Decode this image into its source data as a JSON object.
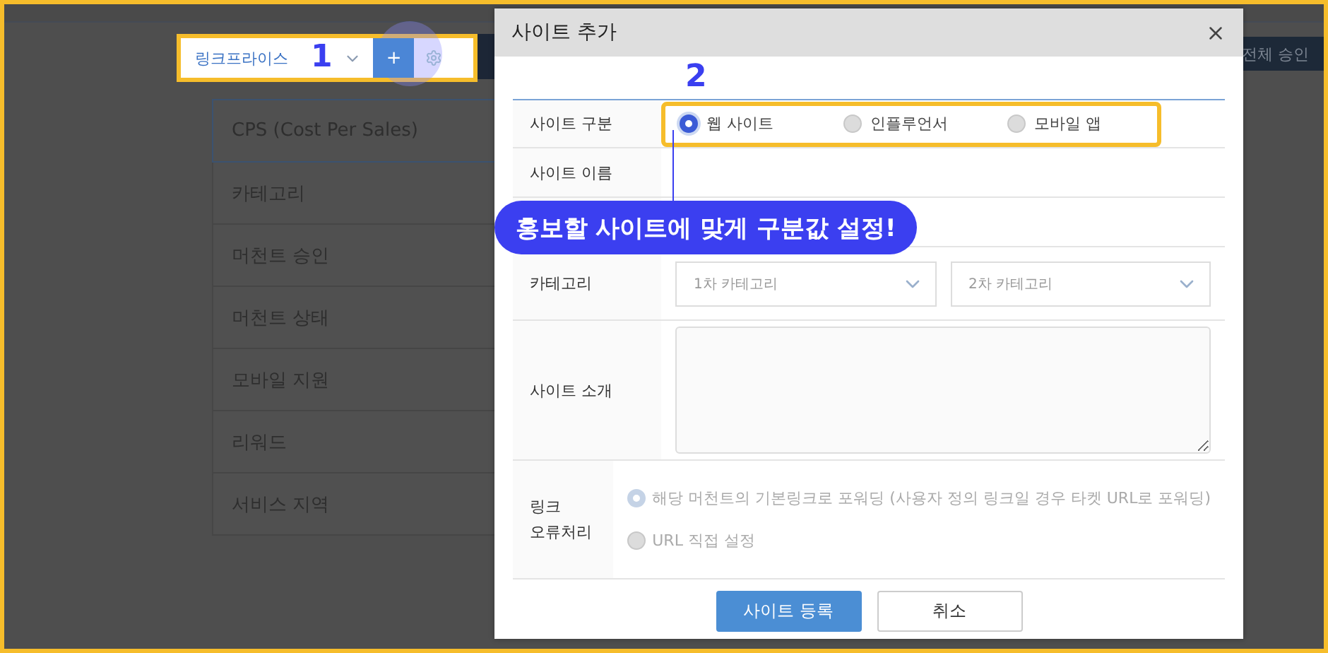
{
  "toolbar": {
    "site_select": "링크프라이스",
    "step_badge": "1",
    "add_button": "+"
  },
  "top_right_button": "전체 승인",
  "menu": [
    {
      "label": "CPS (Cost Per Sales)",
      "selected": true
    },
    {
      "label": "카테고리",
      "selected": false
    },
    {
      "label": "머천트 승인",
      "selected": false
    },
    {
      "label": "머천트 상태",
      "selected": false
    },
    {
      "label": "모바일 지원",
      "selected": false
    },
    {
      "label": "리워드",
      "selected": false
    },
    {
      "label": "서비스 지역",
      "selected": false
    }
  ],
  "dialog": {
    "title": "사이트 추가",
    "step_badge": "2",
    "site_type": {
      "label": "사이트 구분",
      "options": [
        {
          "label": "웹 사이트",
          "selected": true
        },
        {
          "label": "인플루언서",
          "selected": false
        },
        {
          "label": "모바일 앱",
          "selected": false
        }
      ]
    },
    "site_name": {
      "label": "사이트 이름"
    },
    "callout": "홍보할 사이트에 맞게 구분값 설정!",
    "category": {
      "label": "카테고리",
      "selects": [
        {
          "placeholder": "1차 카테고리"
        },
        {
          "placeholder": "2차 카테고리"
        }
      ]
    },
    "intro": {
      "label": "사이트 소개"
    },
    "link_error": {
      "label_lines": [
        "링크",
        "오류처리"
      ],
      "disabled": true,
      "options": [
        {
          "label": "해당 머천트의 기본링크로 포워딩 (사용자 정의 링크일 경우 타켓 URL로 포워딩)",
          "selected": true
        },
        {
          "label": "URL 직접 설정",
          "selected": false
        }
      ]
    },
    "buttons": [
      {
        "label": "사이트 등록",
        "kind": "primary"
      },
      {
        "label": "취소",
        "kind": "secondary"
      }
    ]
  }
}
